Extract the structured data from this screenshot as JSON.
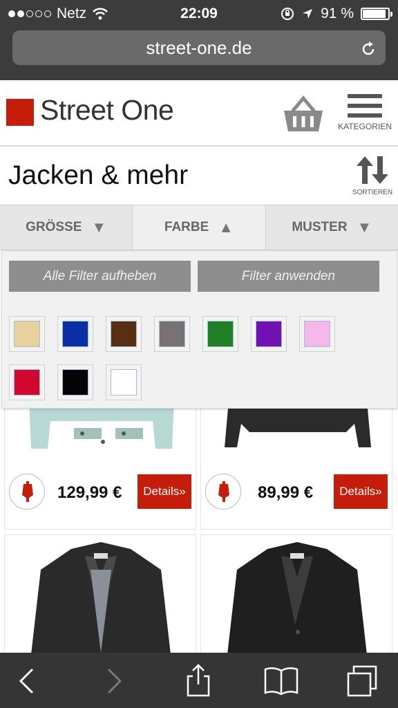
{
  "status_bar": {
    "carrier": "Netz",
    "time": "22:09",
    "battery_percent_label": "91 %",
    "battery_level": 0.91
  },
  "browser": {
    "url": "street-one.de",
    "reload_icon": "reload-icon"
  },
  "header": {
    "logo_text": "Street One",
    "brand_color": "#c61c0b",
    "basket_icon": "basket-icon",
    "menu_icon": "hamburger-menu-icon",
    "menu_label": "KATEGORIEN"
  },
  "page": {
    "title": "Jacken & mehr",
    "sort_label": "SORTIEREN",
    "sort_icon": "sort-arrows-icon"
  },
  "filter_tabs": [
    {
      "label": "GRÖSSE",
      "arrow": "▼",
      "active": false
    },
    {
      "label": "FARBE",
      "arrow": "▲",
      "active": true
    },
    {
      "label": "MUSTER",
      "arrow": "▼",
      "active": false
    }
  ],
  "filter_panel": {
    "clear_label": "Alle Filter aufheben",
    "apply_label": "Filter anwenden",
    "colors": [
      "#e8d19b",
      "#0a2ea5",
      "#5a2e10",
      "#787272",
      "#1f7f25",
      "#7210b3",
      "#f4b8ea",
      "#d0062f",
      "#050505",
      "#ffffff"
    ]
  },
  "products": [
    {
      "price": "129,99 €",
      "details_label": "Details»"
    },
    {
      "price": "89,99 €",
      "details_label": "Details»"
    },
    {
      "price": "",
      "details_label": ""
    },
    {
      "price": "",
      "details_label": ""
    }
  ],
  "toolbar": {
    "icons": [
      "back-icon",
      "forward-icon",
      "share-icon",
      "bookmarks-icon",
      "tabs-icon"
    ]
  }
}
